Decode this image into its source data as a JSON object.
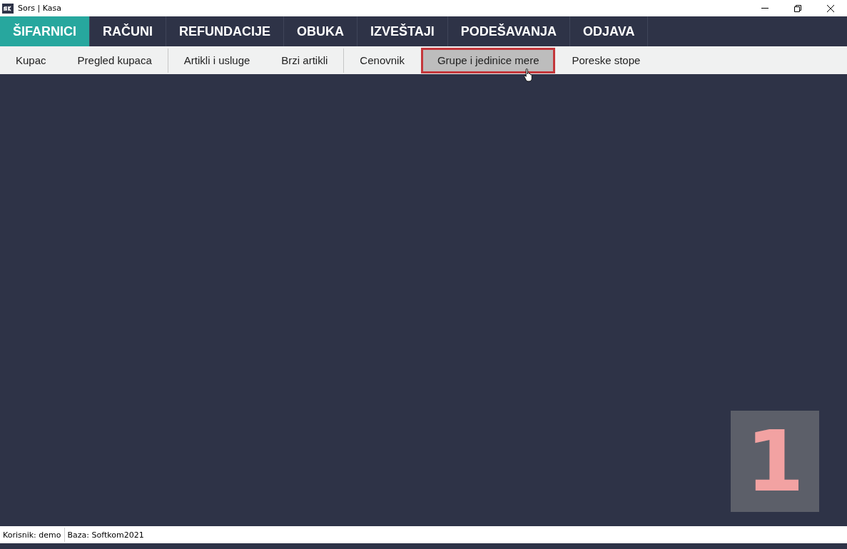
{
  "window": {
    "title": "Sors | Kasa"
  },
  "menu": [
    {
      "label": "ŠIFARNICI",
      "selected": true
    },
    {
      "label": "RAČUNI",
      "selected": false
    },
    {
      "label": "REFUNDACIJE",
      "selected": false
    },
    {
      "label": "OBUKA",
      "selected": false
    },
    {
      "label": "IZVEŠTAJI",
      "selected": false
    },
    {
      "label": "PODEŠAVANJA",
      "selected": false
    },
    {
      "label": "ODJAVA",
      "selected": false
    }
  ],
  "submenu_groups": [
    [
      {
        "label": "Kupac",
        "selected": false
      },
      {
        "label": "Pregled kupaca",
        "selected": false
      }
    ],
    [
      {
        "label": "Artikli i usluge",
        "selected": false
      },
      {
        "label": "Brzi artikli",
        "selected": false
      }
    ],
    [
      {
        "label": "Cenovnik",
        "selected": false
      },
      {
        "label": "Grupe i jedinice mere",
        "selected": true
      },
      {
        "label": "Poreske stope",
        "selected": false
      }
    ]
  ],
  "step_badge": "1",
  "status_bar": [
    "Korisnik: demo",
    "Baza: Softkom2021"
  ]
}
